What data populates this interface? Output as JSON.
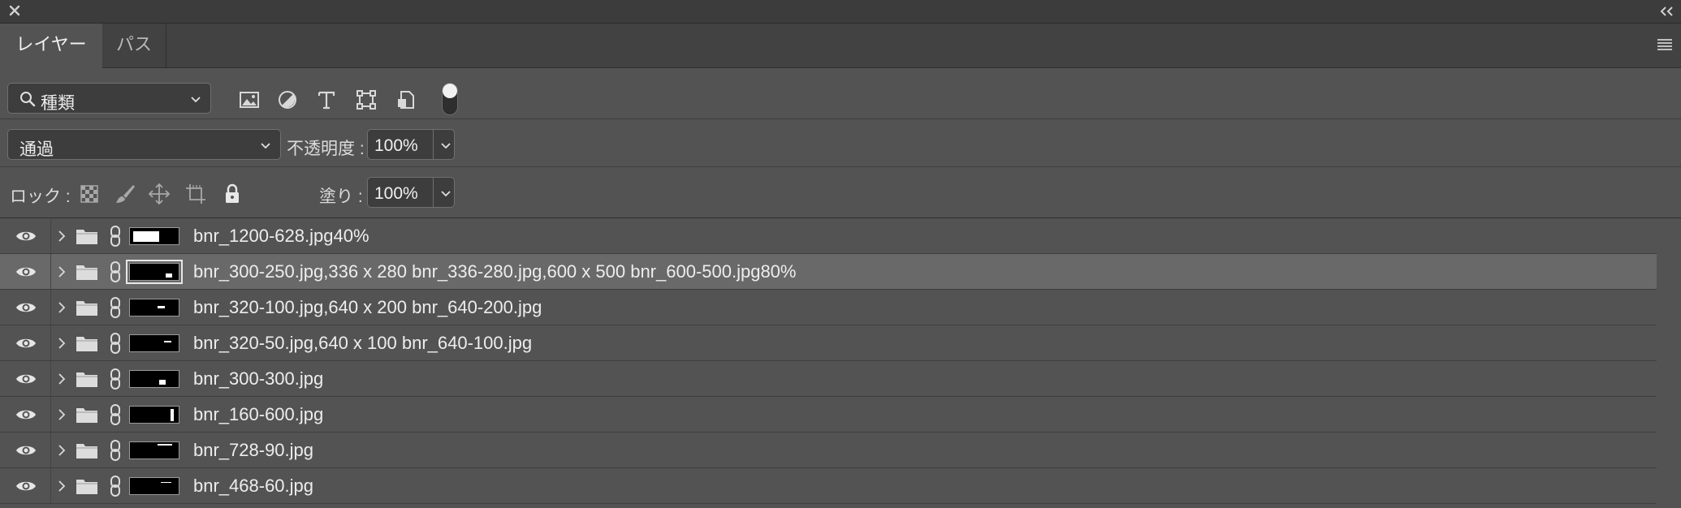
{
  "titlebar": {
    "close_icon": "close-icon",
    "collapse_icon": "double-chevron-left-icon"
  },
  "tabs": [
    {
      "label": "レイヤー",
      "active": true
    },
    {
      "label": "パス",
      "active": false
    }
  ],
  "filter": {
    "kind_label": "種類",
    "icons": [
      "image-filter-icon",
      "adjustment-filter-icon",
      "type-filter-icon",
      "shape-filter-icon",
      "smart-object-filter-icon"
    ]
  },
  "blend": {
    "mode": "通過",
    "opacity_label": "不透明度 :",
    "opacity_value": "100%"
  },
  "lock": {
    "label": "ロック :",
    "icons": [
      "lock-transparent-pixels-icon",
      "lock-image-pixels-icon",
      "lock-position-icon",
      "lock-artboard-icon",
      "lock-all-icon"
    ],
    "fill_label": "塗り :",
    "fill_value": "100%"
  },
  "layers": [
    {
      "name": "bnr_1200-628.jpg40%",
      "selected": false
    },
    {
      "name": "bnr_300-250.jpg,336 x 280 bnr_336-280.jpg,600 x 500 bnr_600-500.jpg80%",
      "selected": true
    },
    {
      "name": "bnr_320-100.jpg,640 x 200 bnr_640-200.jpg",
      "selected": false
    },
    {
      "name": "bnr_320-50.jpg,640 x 100 bnr_640-100.jpg",
      "selected": false
    },
    {
      "name": "bnr_300-300.jpg",
      "selected": false
    },
    {
      "name": "bnr_160-600.jpg",
      "selected": false
    },
    {
      "name": "bnr_728-90.jpg",
      "selected": false
    },
    {
      "name": "bnr_468-60.jpg",
      "selected": false
    }
  ]
}
